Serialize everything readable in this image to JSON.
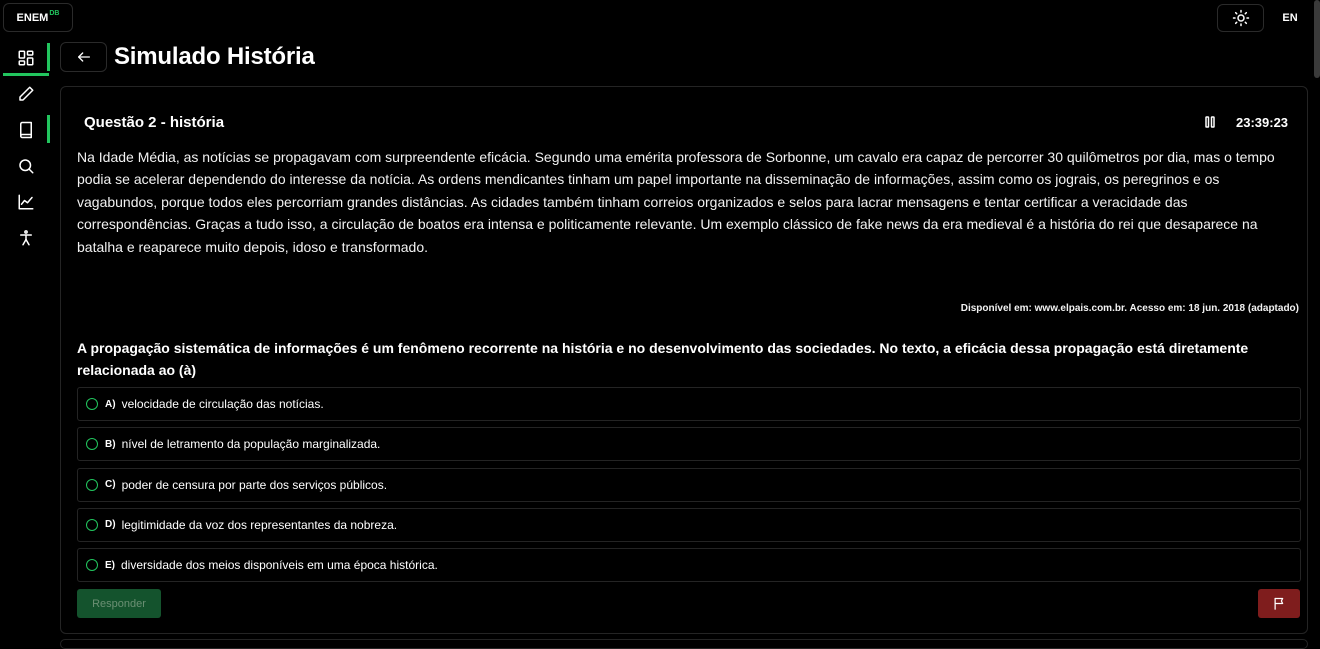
{
  "app": {
    "logo_text": "ENEM",
    "logo_sup": "DB",
    "language": "EN"
  },
  "sidebar": {
    "items": [
      {
        "icon": "dashboard-icon",
        "active": true
      },
      {
        "icon": "pencil-icon",
        "active": false
      },
      {
        "icon": "book-icon",
        "active": true
      },
      {
        "icon": "search-icon",
        "active": false
      },
      {
        "icon": "chart-line-icon",
        "active": false
      },
      {
        "icon": "accessibility-icon",
        "active": false
      }
    ]
  },
  "header": {
    "title": "Simulado História"
  },
  "question": {
    "title": "Questão 2 - história",
    "timer": "23:39:23",
    "passage": "Na Idade Média, as notícias se propagavam com surpreendente eficácia. Segundo uma emérita professora de Sorbonne, um cavalo era capaz de percorrer 30 quilômetros por dia, mas o tempo podia se acelerar dependendo do interesse da notícia. As ordens mendicantes tinham um papel importante na disseminação de informações, assim como os jograis, os peregrinos e os vagabundos, porque todos eles percorriam grandes distâncias. As cidades também tinham correios organizados e selos para lacrar mensagens e tentar certificar a veracidade das correspondências. Graças a tudo isso, a circulação de boatos era intensa e politicamente relevante. Um exemplo clássico de fake news da era medieval é a história do rei que desaparece na batalha e reaparece muito depois, idoso e transformado.",
    "source": "Disponível em: www.elpais.com.br. Acesso em: 18 jun. 2018 (adaptado)",
    "prompt": "A propagação sistemática de informações é um fenômeno recorrente na história e no desenvolvimento das sociedades. No texto, a eficácia dessa propagação está diretamente relacionada ao (à)",
    "options": [
      {
        "letter": "A)",
        "text": "velocidade de circulação das notícias."
      },
      {
        "letter": "B)",
        "text": "nível de letramento da população marginalizada."
      },
      {
        "letter": "C)",
        "text": "poder de censura por parte dos serviços públicos."
      },
      {
        "letter": "D)",
        "text": "legitimidade da voz dos representantes da nobreza."
      },
      {
        "letter": "E)",
        "text": "diversidade dos meios disponíveis em uma época histórica."
      }
    ],
    "respond_label": "Responder"
  },
  "colors": {
    "accent": "#22c55e",
    "respond_bg": "#14532d",
    "flag_bg": "#7f1d1d"
  }
}
